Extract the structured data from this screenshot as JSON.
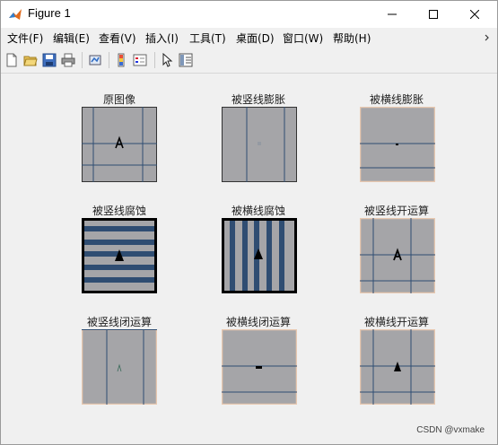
{
  "window": {
    "title": "Figure 1",
    "controls": [
      "minimize",
      "maximize",
      "close"
    ]
  },
  "menubar": {
    "items": [
      "文件(F)",
      "编辑(E)",
      "查看(V)",
      "插入(I)",
      "工具(T)",
      "桌面(D)",
      "窗口(W)",
      "帮助(H)"
    ],
    "overflow_icon": "chevron-icon"
  },
  "toolbar": {
    "icons": [
      "new-figure-icon",
      "open-file-icon",
      "save-icon",
      "print-icon",
      "link-plot-icon",
      "insert-colorbar-icon",
      "insert-legend-icon",
      "pointer-icon",
      "property-editor-icon"
    ]
  },
  "figure": {
    "subplots": [
      {
        "title": "原图像",
        "pattern": "grid-plus-letter"
      },
      {
        "title": "被竖线膨胀",
        "pattern": "vertical-lines-faint"
      },
      {
        "title": "被横线膨胀",
        "pattern": "horizontal-lines-dot"
      },
      {
        "title": "被竖线腐蚀",
        "pattern": "thick-horizontal-bands"
      },
      {
        "title": "被横线腐蚀",
        "pattern": "thick-vertical-bands"
      },
      {
        "title": "被竖线开运算",
        "pattern": "grid-plus-letter"
      },
      {
        "title": "被竖线闭运算",
        "pattern": "vertical-lines-small"
      },
      {
        "title": "被横线闭运算",
        "pattern": "horizontal-lines-dash"
      },
      {
        "title": "被横线开运算",
        "pattern": "grid-plus-letter-bold"
      }
    ]
  },
  "watermark": "CSDN @vxmake",
  "colors": {
    "panel_gray": "#a5a5a8",
    "line_blue": "#2f4d72",
    "border_peach": "#e8c8b0"
  }
}
